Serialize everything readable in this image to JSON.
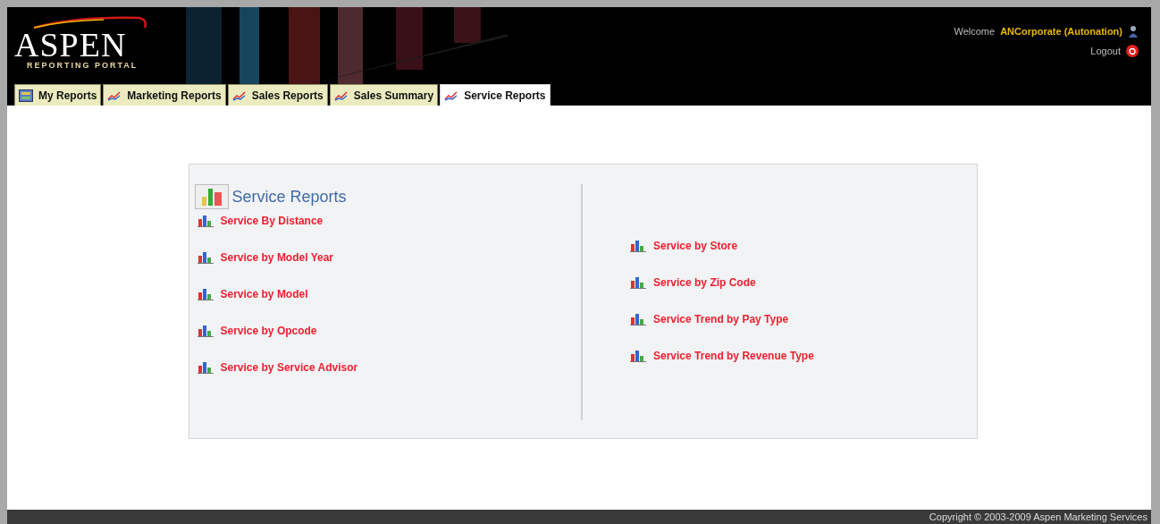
{
  "logo": {
    "name": "ASPEN",
    "subtitle": "REPORTING PORTAL"
  },
  "user": {
    "welcome": "Welcome",
    "name": "ANCorporate (Autonation)",
    "logout": "Logout"
  },
  "tabs": [
    {
      "label": "My Reports",
      "kind": "grid",
      "selected": false
    },
    {
      "label": "Marketing Reports",
      "kind": "chart",
      "selected": false
    },
    {
      "label": "Sales Reports",
      "kind": "chart",
      "selected": false
    },
    {
      "label": "Sales Summary",
      "kind": "chart",
      "selected": false
    },
    {
      "label": "Service Reports",
      "kind": "chart",
      "selected": true
    }
  ],
  "panel": {
    "title": "Service Reports",
    "left_links": [
      "Service By Distance",
      "Service by Model Year",
      "Service by Model",
      "Service by Opcode",
      "Service by Service Advisor"
    ],
    "right_links": [
      "Service by Store",
      "Service by Zip Code",
      "Service Trend by Pay Type",
      "Service Trend by Revenue Type"
    ]
  },
  "footer": "Copyright © 2003-2009  Aspen Marketing Services"
}
